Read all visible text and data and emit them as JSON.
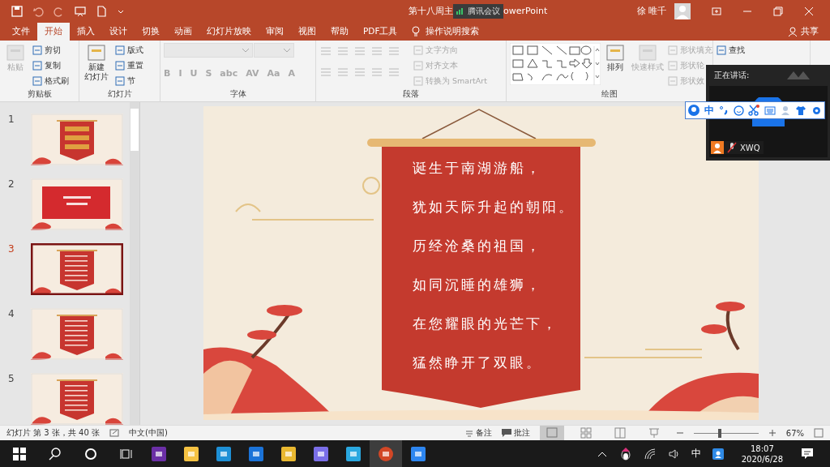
{
  "window": {
    "title_start": "第十八周主",
    "title_end": "owerPoint",
    "user": "徐 唯千"
  },
  "meeting_badge": "腾讯会议",
  "menu_tabs": [
    {
      "label": "文件",
      "selected": false
    },
    {
      "label": "开始",
      "selected": true
    },
    {
      "label": "插入",
      "selected": false
    },
    {
      "label": "设计",
      "selected": false
    },
    {
      "label": "切换",
      "selected": false
    },
    {
      "label": "动画",
      "selected": false
    },
    {
      "label": "幻灯片放映",
      "selected": false
    },
    {
      "label": "审阅",
      "selected": false
    },
    {
      "label": "视图",
      "selected": false
    },
    {
      "label": "帮助",
      "selected": false
    },
    {
      "label": "PDF工具",
      "selected": false
    }
  ],
  "tell_me": "操作说明搜索",
  "share": "共享",
  "ribbon": [
    {
      "label": "剪贴板",
      "items": [
        {
          "kind": "large",
          "label": "粘贴",
          "disabled": true
        },
        {
          "kind": "small",
          "label": "剪切",
          "disabled": false
        },
        {
          "kind": "small",
          "label": "复制",
          "disabled": false
        },
        {
          "kind": "small",
          "label": "格式刷",
          "disabled": false
        }
      ]
    },
    {
      "label": "幻灯片",
      "items": [
        {
          "kind": "large",
          "label": "新建",
          "label_2": "幻灯片",
          "disabled": false
        },
        {
          "kind": "small",
          "label": "版式",
          "disabled": false
        },
        {
          "kind": "small",
          "label": "重置",
          "disabled": false
        },
        {
          "kind": "small",
          "label": "节",
          "disabled": false
        }
      ]
    },
    {
      "label": "字体",
      "items": [
        {
          "kind": "combo",
          "disabled": true
        },
        {
          "kind": "glyph",
          "label": "B",
          "disabled": true
        },
        {
          "kind": "glyph",
          "label": "I",
          "disabled": true
        },
        {
          "kind": "glyph",
          "label": "U",
          "disabled": true
        },
        {
          "kind": "glyph",
          "label": "S",
          "disabled": true
        },
        {
          "kind": "glyph",
          "label": "abc",
          "disabled": true
        },
        {
          "kind": "glyph",
          "label": "AV",
          "disabled": true
        },
        {
          "kind": "glyph",
          "label": "Aa",
          "disabled": true
        },
        {
          "kind": "glyph",
          "label": "A",
          "disabled": true
        }
      ]
    },
    {
      "label": "段落",
      "items": [
        {
          "kind": "icons",
          "disabled": true
        },
        {
          "kind": "small",
          "label": "文字方向",
          "disabled": true
        },
        {
          "kind": "small",
          "label": "对齐文本",
          "disabled": true
        },
        {
          "kind": "small",
          "label": "转换为 SmartArt",
          "disabled": true
        }
      ]
    },
    {
      "label": "绘图",
      "items": [
        {
          "kind": "shapes",
          "disabled": false
        },
        {
          "kind": "large",
          "label": "排列",
          "disabled": false
        },
        {
          "kind": "large",
          "label": "快速样式",
          "disabled": true
        },
        {
          "kind": "small",
          "label": "形状填充",
          "disabled": true
        },
        {
          "kind": "small",
          "label": "形状轮",
          "disabled": true
        },
        {
          "kind": "small",
          "label": "形状效",
          "disabled": true
        }
      ]
    },
    {
      "items": [
        {
          "kind": "small",
          "label": "查找",
          "disabled": false
        }
      ]
    }
  ],
  "thumbnails": [
    {
      "number": "1",
      "selected": false,
      "kind": "title"
    },
    {
      "number": "2",
      "selected": false,
      "kind": "question"
    },
    {
      "number": "3",
      "selected": true,
      "kind": "poem"
    },
    {
      "number": "4",
      "selected": false,
      "kind": "poem"
    },
    {
      "number": "5",
      "selected": false,
      "kind": "poem"
    }
  ],
  "slide": {
    "lines": [
      "诞生于南湖游船，",
      "犹如天际升起的朝阳。",
      "历经沧桑的祖国，",
      "如同沉睡的雄狮，",
      "在您耀眼的光芒下，",
      "猛然睁开了双眼。"
    ]
  },
  "meeting": {
    "speaking_label": "正在讲话:",
    "participant": "XWQ",
    "muted": true
  },
  "ime_bar": {
    "mode": "中"
  },
  "status_bar": {
    "slide_info": "幻灯片 第 3 张，共 40 张",
    "language": "中文(中国)",
    "notes": "备注",
    "comments": "批注",
    "zoom": {
      "level": 0.4
    },
    "zoom_text": "67%"
  },
  "taskbar": {
    "apps": [
      {
        "active": false
      },
      {
        "active": false
      },
      {
        "active": false
      },
      {
        "active": false
      },
      {
        "active": false
      },
      {
        "active": false
      },
      {
        "active": false
      },
      {
        "active": true
      },
      {
        "active": false
      }
    ],
    "ime": "中",
    "time": "18:07",
    "date": "2020/6/28"
  }
}
